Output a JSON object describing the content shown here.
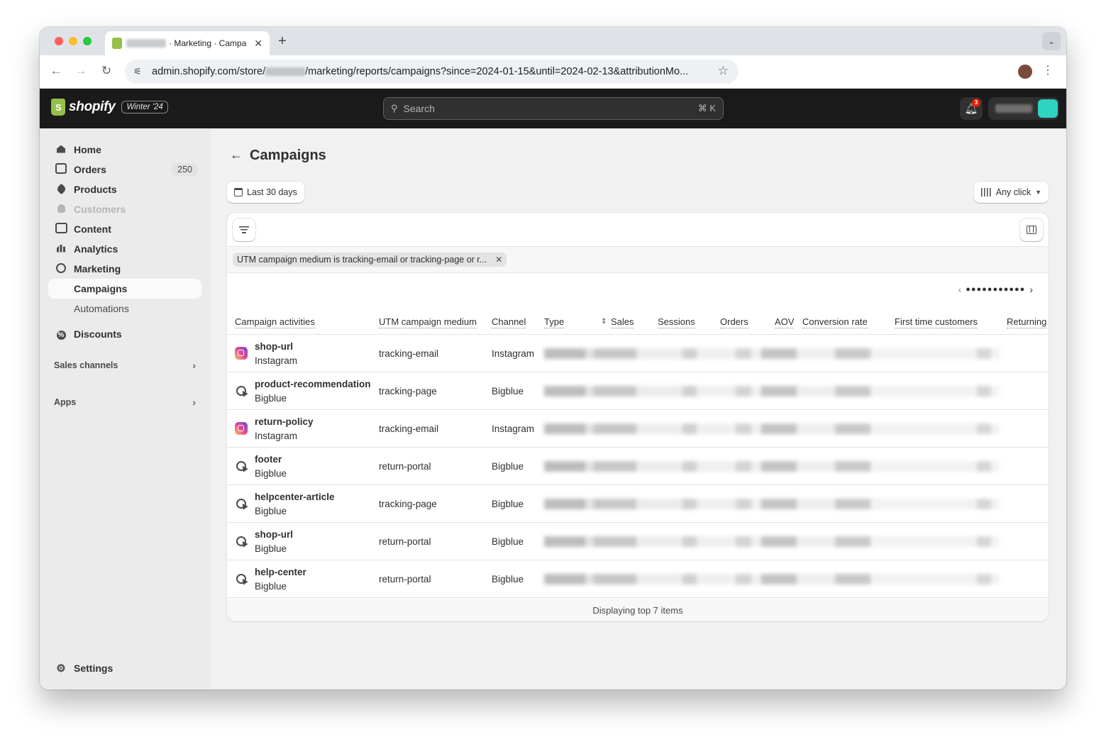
{
  "browser": {
    "tab_title": "· Marketing · Campa",
    "url_prefix": "admin.shopify.com/store/",
    "url_suffix": "/marketing/reports/campaigns?since=2024-01-15&until=2024-02-13&attributionMo...",
    "new_tab": "+",
    "tab_close": "✕",
    "tab_menu": "⌄"
  },
  "topbar": {
    "logo_text": "shopify",
    "edition_badge": "Winter '24",
    "search_placeholder": "Search",
    "search_shortcut": "⌘ K",
    "notification_count": "3"
  },
  "sidebar": {
    "items": [
      {
        "label": "Home",
        "icon": "home-icon"
      },
      {
        "label": "Orders",
        "icon": "orders-icon",
        "count": "250"
      },
      {
        "label": "Products",
        "icon": "tag-icon"
      },
      {
        "label": "Customers",
        "icon": "person-icon",
        "disabled": true
      },
      {
        "label": "Content",
        "icon": "content-icon"
      },
      {
        "label": "Analytics",
        "icon": "analytics-icon"
      },
      {
        "label": "Marketing",
        "icon": "target-icon"
      },
      {
        "label": "Campaigns",
        "active": true
      },
      {
        "label": "Automations"
      },
      {
        "label": "Discounts",
        "icon": "discount-icon"
      }
    ],
    "sections": [
      "Sales channels",
      "Apps"
    ],
    "settings_label": "Settings"
  },
  "main": {
    "title": "Campaigns",
    "date_range_button": "Last 30 days",
    "attribution_button": "Any click",
    "filter_chip": "UTM campaign medium is tracking-email or tracking-page or r...",
    "pager_dots": "●●●●●●●●●●●",
    "footer": "Displaying top 7 items"
  },
  "table": {
    "columns": [
      "Campaign activities",
      "UTM campaign medium",
      "Channel",
      "Type",
      "Sales",
      "Sessions",
      "Orders",
      "AOV",
      "Conversion rate",
      "First time customers",
      "Returning"
    ],
    "rows": [
      {
        "name": "shop-url",
        "source": "Instagram",
        "medium": "tracking-email",
        "channel": "Instagram",
        "icon": "instagram-icon"
      },
      {
        "name": "product-recommendation",
        "source": "Bigblue",
        "medium": "tracking-page",
        "channel": "Bigblue",
        "icon": "bigblue-icon"
      },
      {
        "name": "return-policy",
        "source": "Instagram",
        "medium": "tracking-email",
        "channel": "Instagram",
        "icon": "instagram-icon"
      },
      {
        "name": "footer",
        "source": "Bigblue",
        "medium": "return-portal",
        "channel": "Bigblue",
        "icon": "bigblue-icon"
      },
      {
        "name": "helpcenter-article",
        "source": "Bigblue",
        "medium": "tracking-page",
        "channel": "Bigblue",
        "icon": "bigblue-icon"
      },
      {
        "name": "shop-url",
        "source": "Bigblue",
        "medium": "return-portal",
        "channel": "Bigblue",
        "icon": "bigblue-icon"
      },
      {
        "name": "help-center",
        "source": "Bigblue",
        "medium": "return-portal",
        "channel": "Bigblue",
        "icon": "bigblue-icon"
      }
    ]
  },
  "colors": {
    "topbar_bg": "#1a1a1a",
    "sidebar_bg": "#ebebeb",
    "page_bg": "#f1f1f1",
    "brand_green": "#95bf47",
    "badge_red": "#e51c00"
  }
}
